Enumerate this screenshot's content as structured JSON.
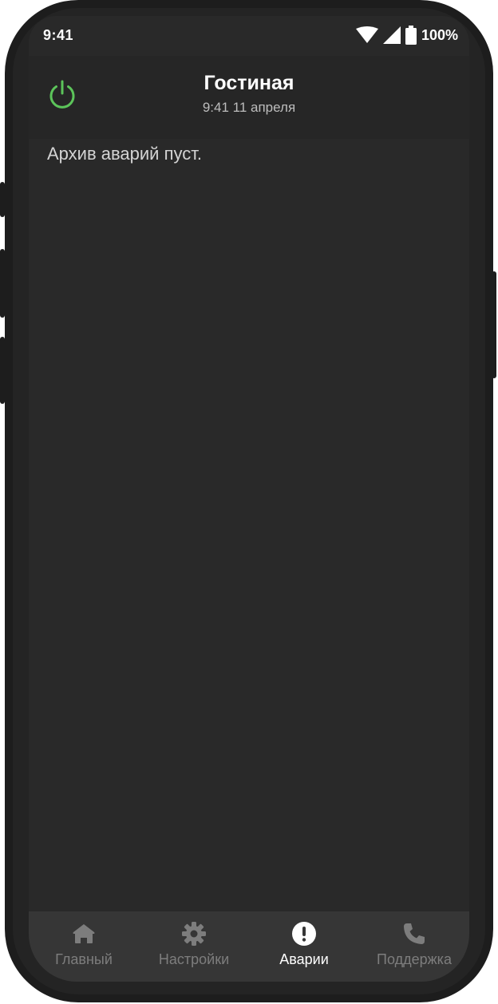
{
  "status_bar": {
    "time": "9:41",
    "battery": "100%",
    "icons": [
      "wifi-icon",
      "signal-icon",
      "battery-icon"
    ]
  },
  "header": {
    "title": "Гостиная",
    "subtitle": "9:41 11 апреля",
    "power_icon": "power-icon",
    "power_color": "#5cc45a"
  },
  "main": {
    "empty_message": "Архив аварий пуст."
  },
  "bottom_nav": {
    "items": [
      {
        "label": "Главный",
        "icon": "home-icon",
        "active": false
      },
      {
        "label": "Настройки",
        "icon": "gear-icon",
        "active": false
      },
      {
        "label": "Аварии",
        "icon": "alert-icon",
        "active": true
      },
      {
        "label": "Поддержка",
        "icon": "phone-icon",
        "active": false
      }
    ]
  },
  "colors": {
    "background": "#292929",
    "nav_background": "#363636",
    "active": "#ffffff",
    "inactive": "#7d7d7d"
  }
}
